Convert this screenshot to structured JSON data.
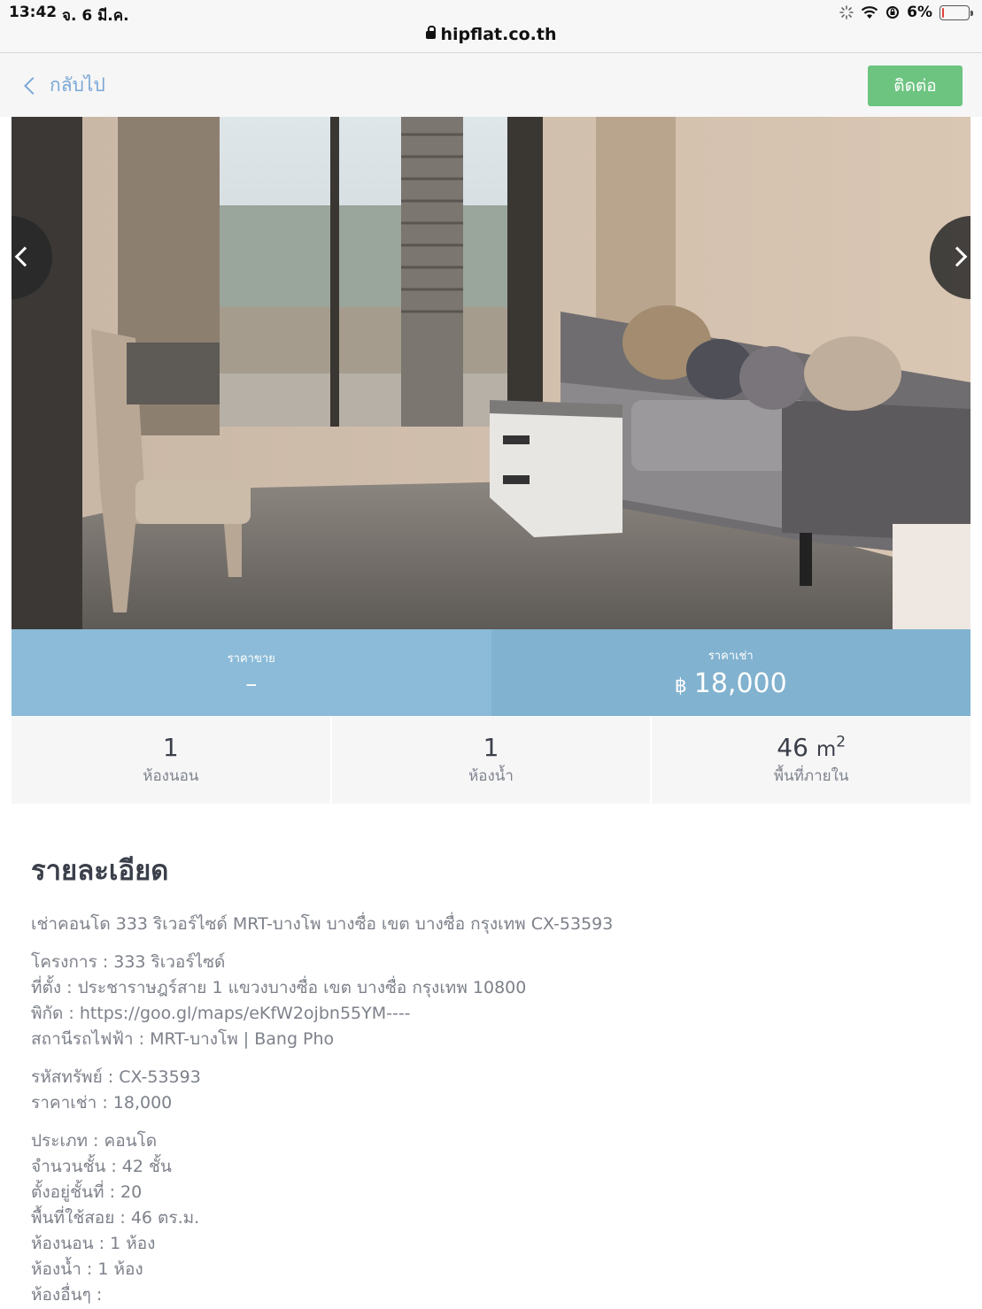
{
  "status_bar": {
    "time": "13:42",
    "date": "จ. 6 มี.ค.",
    "battery": "6%",
    "battery_level": 0.06
  },
  "browser": {
    "url": "hipflat.co.th"
  },
  "nav": {
    "back_label": "กลับไป",
    "contact_label": "ติดต่อ"
  },
  "prices": {
    "sale_label": "ราคาขาย",
    "sale_value": "–",
    "rent_label": "ราคาเช่า",
    "rent_currency": "฿",
    "rent_value": "18,000"
  },
  "stats": {
    "bedrooms": {
      "value": "1",
      "label": "ห้องนอน"
    },
    "bathrooms": {
      "value": "1",
      "label": "ห้องน้ำ"
    },
    "area": {
      "value": "46",
      "unit": "m",
      "sup": "2",
      "label": "พื้นที่ภายใน"
    }
  },
  "details": {
    "heading": "รายละเอียด",
    "groups": [
      [
        "เช่าคอนโด 333 ริเวอร์ไซด์ MRT-บางโพ บางซื่อ เขต บางซื่อ กรุงเทพ CX-53593"
      ],
      [
        "โครงการ : 333 ริเวอร์ไซด์",
        "ที่ตั้ง : ประชาราษฎร์สาย 1 แขวงบางซื่อ เขต บางซื่อ กรุงเทพ 10800",
        "พิกัด : https://goo.gl/maps/eKfW2ojbn55YM----",
        "สถานีรถไฟฟ้า : MRT-บางโพ | Bang Pho"
      ],
      [
        "รหัสทรัพย์ : CX-53593",
        "ราคาเช่า : 18,000"
      ],
      [
        "ประเภท : คอนโด",
        "จำนวนชั้น : 42 ชั้น",
        "ตั้งอยู่ชั้นที่ : 20",
        "พื้นที่ใช้สอย : 46 ตร.ม.",
        "ห้องนอน : 1 ห้อง",
        "ห้องน้ำ : 1 ห้อง",
        "ห้องอื่นๆ :"
      ]
    ]
  }
}
